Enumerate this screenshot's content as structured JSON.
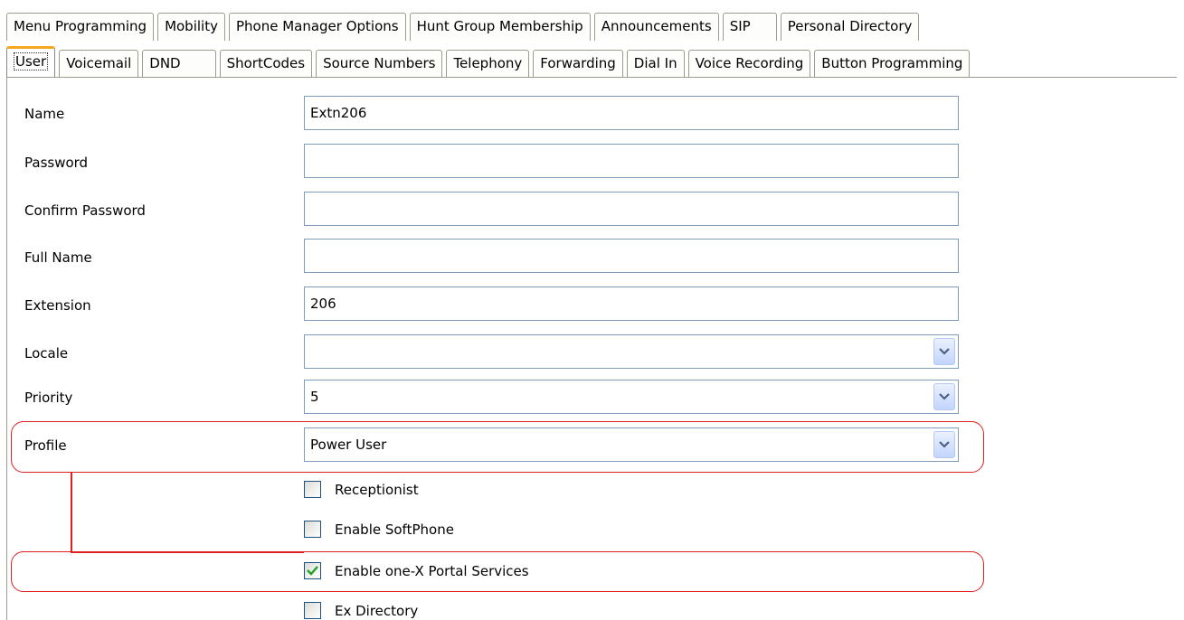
{
  "tabs_back": [
    "Menu Programming",
    "Mobility",
    "Phone Manager Options",
    "Hunt Group Membership",
    "Announcements",
    "SIP",
    "Personal Directory"
  ],
  "tabs_front": [
    "User",
    "Voicemail",
    "DND",
    "ShortCodes",
    "Source Numbers",
    "Telephony",
    "Forwarding",
    "Dial In",
    "Voice Recording",
    "Button Programming"
  ],
  "active_tab": "User",
  "form": {
    "name": {
      "label": "Name",
      "value": "Extn206"
    },
    "password": {
      "label": "Password",
      "value": ""
    },
    "confirm_password": {
      "label": "Confirm Password",
      "value": ""
    },
    "full_name": {
      "label": "Full Name",
      "value": ""
    },
    "extension": {
      "label": "Extension",
      "value": "206"
    },
    "locale": {
      "label": "Locale",
      "value": ""
    },
    "priority": {
      "label": "Priority",
      "value": "5"
    },
    "profile": {
      "label": "Profile",
      "value": "Power User"
    }
  },
  "checkboxes": {
    "receptionist": {
      "label": "Receptionist",
      "checked": false
    },
    "softphone": {
      "label": "Enable SoftPhone",
      "checked": false
    },
    "onex": {
      "label": "Enable one-X Portal Services",
      "checked": true
    },
    "exdir": {
      "label": "Ex Directory",
      "checked": false
    }
  },
  "colors": {
    "highlight": "#e02020",
    "active_tab_accent": "#f5a623",
    "field_border": "#7f9db9"
  },
  "icons": {
    "dropdown": "chevron-down-icon",
    "check": "checkmark-icon"
  }
}
